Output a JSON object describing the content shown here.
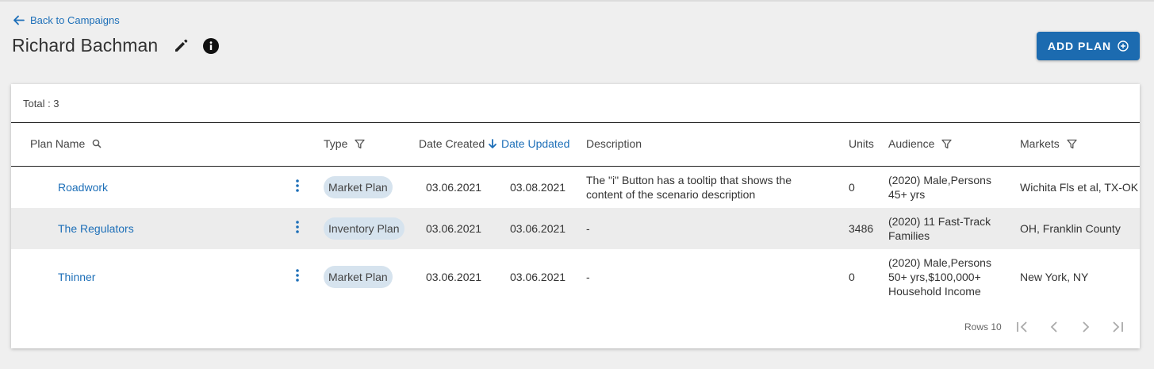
{
  "nav": {
    "back_label": "Back to Campaigns"
  },
  "header": {
    "title": "Richard Bachman"
  },
  "actions": {
    "add_plan_label": "ADD PLAN"
  },
  "table": {
    "total_label": "Total : 3",
    "columns": {
      "plan_name": "Plan Name",
      "type": "Type",
      "date_created": "Date Created",
      "date_updated": "Date Updated",
      "description": "Description",
      "units": "Units",
      "audience": "Audience",
      "markets": "Markets"
    },
    "rows": [
      {
        "name": "Roadwork",
        "type": "Market Plan",
        "created": "03.06.2021",
        "updated": "03.08.2021",
        "description": "The \"i\" Button has a tooltip that shows the content of the scenario description",
        "units": "0",
        "audience": "(2020) Male,Persons 45+ yrs",
        "markets": "Wichita Fls et al, TX-OK"
      },
      {
        "name": "The Regulators",
        "type": "Inventory Plan",
        "created": "03.06.2021",
        "updated": "03.06.2021",
        "description": "-",
        "units": "3486",
        "audience": "(2020) 11 Fast-Track Families",
        "markets": "OH, Franklin County"
      },
      {
        "name": "Thinner",
        "type": "Market Plan",
        "created": "03.06.2021",
        "updated": "03.06.2021",
        "description": "-",
        "units": "0",
        "audience": "(2020) Male,Persons 50+ yrs,$100,000+ Household Income",
        "markets": "New York, NY"
      }
    ]
  },
  "pagination": {
    "rows_label": "Rows 10"
  },
  "colors": {
    "accent": "#1c6bb0",
    "link": "#1d6fb8",
    "chip": "#d6e3ee",
    "row_alt": "#ececec"
  }
}
